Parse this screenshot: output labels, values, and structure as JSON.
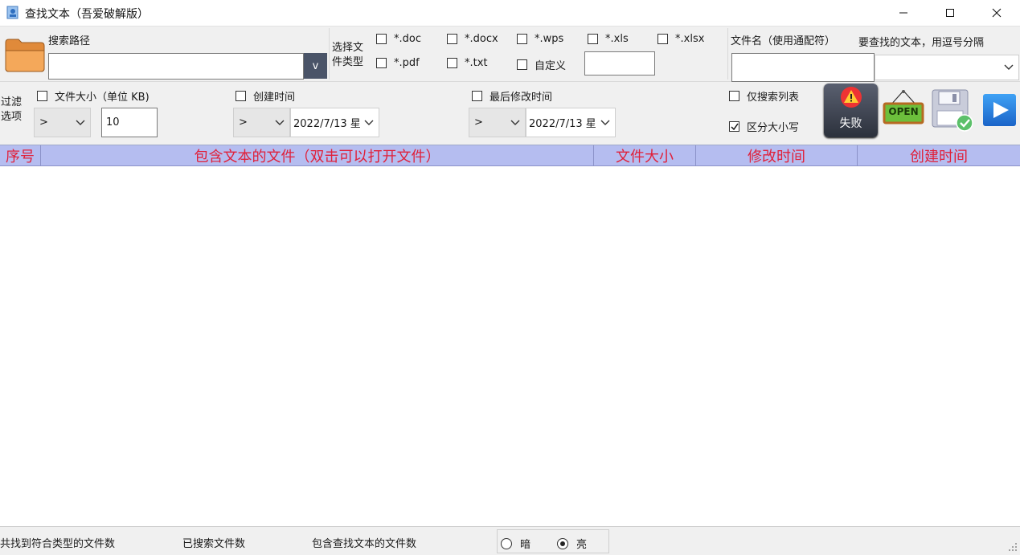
{
  "window": {
    "title": "查找文本（吾爱破解版）"
  },
  "search_path": {
    "label": "搜索路径",
    "value": "",
    "browse_label": "v"
  },
  "file_types": {
    "label_line1": "选择文",
    "label_line2": "件类型",
    "options": [
      {
        "label": "*.doc",
        "checked": false
      },
      {
        "label": "*.docx",
        "checked": false
      },
      {
        "label": "*.wps",
        "checked": false
      },
      {
        "label": "*.xls",
        "checked": false
      },
      {
        "label": "*.xlsx",
        "checked": false
      },
      {
        "label": "*.pdf",
        "checked": false
      },
      {
        "label": "*.txt",
        "checked": false
      },
      {
        "label": "自定义",
        "checked": false
      }
    ],
    "custom_value": ""
  },
  "filename": {
    "label": "文件名（使用通配符）",
    "value": ""
  },
  "search_text": {
    "label": "要查找的文本，用逗号分隔",
    "value": ""
  },
  "filter": {
    "label_line1": "过滤",
    "label_line2": "选项",
    "size": {
      "label": "文件大小（单位 KB)",
      "checked": false,
      "operator": ">",
      "value": "10"
    },
    "created": {
      "label": "创建时间",
      "checked": false,
      "operator": ">",
      "date": "2022/7/13 星"
    },
    "modified": {
      "label": "最后修改时间",
      "checked": false,
      "operator": ">",
      "date": "2022/7/13 星"
    }
  },
  "options": {
    "list_only": {
      "label": "仅搜索列表",
      "checked": false
    },
    "case_sensitive": {
      "label": "区分大小写",
      "checked": true
    }
  },
  "actions": {
    "search_status_label": "失败",
    "open_label": "OPEN"
  },
  "table": {
    "columns": [
      "序号",
      "包含文本的文件（双击可以打开文件）",
      "文件大小",
      "修改时间",
      "创建时间"
    ],
    "rows": []
  },
  "status": {
    "matched_types": "共找到符合类型的文件数",
    "searched": "已搜索文件数",
    "containing": "包含查找文本的文件数",
    "theme_dark": "暗",
    "theme_light": "亮",
    "theme_selected": "light"
  },
  "colors": {
    "header_bg": "#b5bdf0",
    "header_text": "#e0203a",
    "accent_blue": "#2f7fd8"
  }
}
